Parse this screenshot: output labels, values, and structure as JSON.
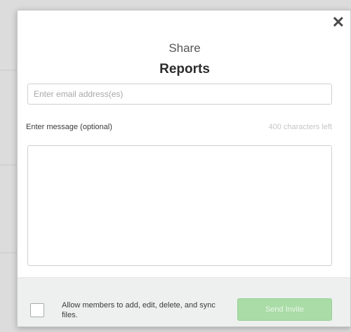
{
  "dialog": {
    "title": "Share",
    "subtitle": "Reports",
    "close_icon": "close-icon",
    "close_glyph": "✕"
  },
  "email": {
    "placeholder": "Enter email address(es)",
    "value": ""
  },
  "message": {
    "label": "Enter message (optional)",
    "counter": "400 characters left",
    "value": ""
  },
  "footer": {
    "checkbox_label": "Allow members to add, edit, delete, and sync files.",
    "checkbox_checked": false,
    "send_label": "Send Invite"
  },
  "colors": {
    "send_button": "#a9dca7",
    "footer_bg": "#eef0ef"
  }
}
